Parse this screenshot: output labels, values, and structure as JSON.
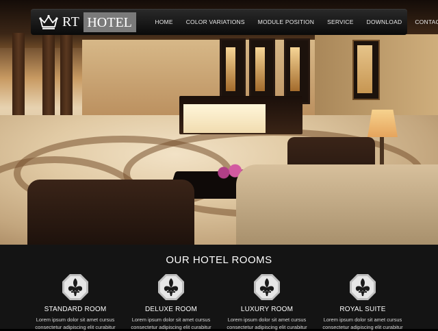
{
  "logo": {
    "prefix": "RT",
    "name": "HOTEL"
  },
  "nav": {
    "items": [
      "HOME",
      "COLOR VARIATIONS",
      "MODULE POSITION",
      "SERVICE",
      "DOWNLOAD",
      "CONTACT"
    ]
  },
  "rooms": {
    "title": "OUR HOTEL ROOMS",
    "items": [
      {
        "name": "STANDARD ROOM",
        "line1": "Lorem ipsum dolor sit amet cursus",
        "line2": "consectetur adipiscing elit curabitur"
      },
      {
        "name": "DELUXE ROOM",
        "line1": "Lorem ipsum dolor sit amet cursus",
        "line2": "consectetur adipiscing elit curabitur"
      },
      {
        "name": "LUXURY ROOM",
        "line1": "Lorem ipsum dolor sit amet cursus",
        "line2": "consectetur adipiscing elit curabitur"
      },
      {
        "name": "ROYAL SUITE",
        "line1": "Lorem ipsum dolor sit amet cursus",
        "line2": "consectetur adipiscing elit curabitur"
      }
    ]
  },
  "icons": {
    "logo": "crown-icon",
    "room": "fleur-de-lis-icon"
  },
  "colors": {
    "nav_bg": "#111111",
    "logo_badge": "#7a7a7a",
    "rooms_bg": "#141414",
    "text": "#ffffff"
  }
}
